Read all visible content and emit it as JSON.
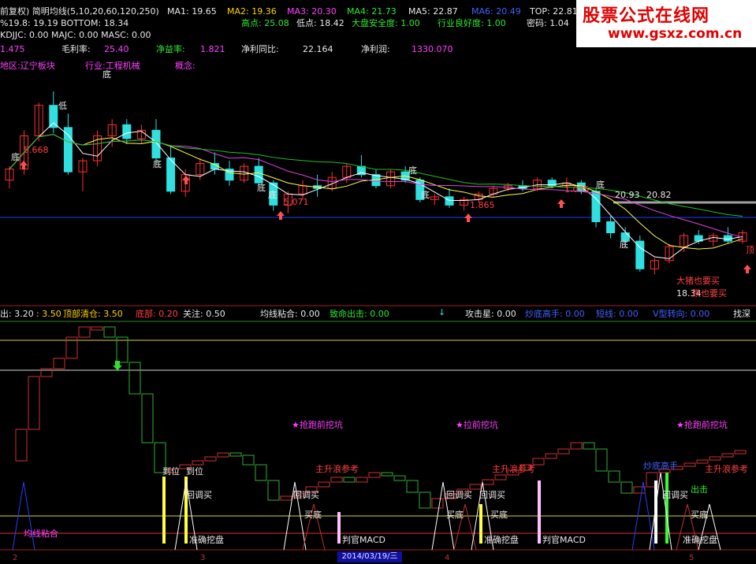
{
  "header": {
    "row1": [
      "前复权) 简明均线(5,10,20,60,120,250)",
      "MA1: 19.65",
      "MA2: 19.36",
      "MA3: 20.30",
      "MA4: 21.73",
      "MA5: 22.87",
      "MA6: 20.49",
      "TOP: 22.81"
    ],
    "row2a": "%19.8: 19.19 BOTTOM: 18.34",
    "row2b": [
      "高点: 25.08",
      "低点: 18.42",
      "大盘安全度: 1.00",
      "行业良好度: 1.00",
      "密码: 1.04"
    ],
    "row3": "KDJJC: 0.00  MAJC: 0.00  MASC: 0.00",
    "row4": [
      "1.475",
      "毛利率:",
      "25.40",
      "净益率:",
      "1.821",
      "净利同比:",
      "22.164",
      "净利润:",
      "1330.070"
    ],
    "row5": [
      "地区:辽宁板块",
      "行业:工程机械",
      "概念:"
    ]
  },
  "main_labels": {
    "low_a": "5.668",
    "low_b": "5.071",
    "low_c": "1.865",
    "low_d": "1.035",
    "flat_1": "20.93",
    "flat_2": "20.82",
    "low_final": "18.34",
    "note_1": "大猪也要买",
    "note_2": "跌也要买",
    "bottom_tag": "底",
    "bottom_tag2": "低",
    "ding_tag": "顶"
  },
  "indicator_row": {
    "items": [
      "出: 3.20",
      ": 3.50",
      "顶部清仓: 3.50",
      "底部: 0.20",
      "关注: 0.50",
      "均线粘合: 0.00",
      "致命出击: 0.00",
      "攻击星: 0.00",
      "炒底高手: 0.00",
      "短线: 0.00",
      "V型转向: 0.00",
      "找深"
    ]
  },
  "lower_labels": {
    "dig_1": "★抢跑前挖坑",
    "dig_2": "★拉前挖坑",
    "dig_3": "★抢跑前挖坑",
    "arrive_1": "到位",
    "arrive_2": "到位",
    "main_up_1": "主升浪参考",
    "main_up_2": "主升浪参考",
    "main_up_3": "主升浪参考",
    "pullback": [
      "回调买",
      "回调买",
      "回调买",
      "回调买",
      "回调买"
    ],
    "buy_bottom": [
      "买底",
      "买底",
      "买底",
      "买底"
    ],
    "ma_stick": "均线粘合",
    "accurate": [
      "准确挖盘",
      "准确挖盘",
      "准确挖盘"
    ],
    "macd": [
      "判官MACD",
      "判官MACD"
    ],
    "deep_buy": "炒底高手",
    "attack": "出击"
  },
  "axis": {
    "marks": [
      "2",
      "3",
      "4",
      "5"
    ],
    "date": "2014/03/19/三"
  },
  "brand": {
    "title": "股票公式在线网",
    "url": "www.gsxz.com.cn"
  },
  "colors": {
    "up": "#ff3030",
    "down": "#30e0e0",
    "ma_white": "#ffffff",
    "ma_yellow": "#ffff40",
    "ma_magenta": "#e040e0",
    "ma_green": "#20c020",
    "ma_blue": "#2040ff"
  },
  "chart_data": {
    "type": "candlestick",
    "candles": [
      [
        21.8,
        22.3,
        21.5,
        22.2
      ],
      [
        22.2,
        23.6,
        22.0,
        23.4
      ],
      [
        23.4,
        24.6,
        23.2,
        24.5
      ],
      [
        24.5,
        25.0,
        23.5,
        23.7
      ],
      [
        23.7,
        24.2,
        22.0,
        22.1
      ],
      [
        22.1,
        22.6,
        21.4,
        22.5
      ],
      [
        22.5,
        23.6,
        22.3,
        23.4
      ],
      [
        23.4,
        24.0,
        23.0,
        23.8
      ],
      [
        23.8,
        24.0,
        23.1,
        23.3
      ],
      [
        23.3,
        23.8,
        23.1,
        23.6
      ],
      [
        23.6,
        24.0,
        22.4,
        22.6
      ],
      [
        22.6,
        23.0,
        21.3,
        21.4
      ],
      [
        21.4,
        22.2,
        21.2,
        22.0
      ],
      [
        22.0,
        22.6,
        21.8,
        22.4
      ],
      [
        22.4,
        22.8,
        22.0,
        22.2
      ],
      [
        22.2,
        22.5,
        21.6,
        21.8
      ],
      [
        21.8,
        22.4,
        21.7,
        22.3
      ],
      [
        22.3,
        22.6,
        21.6,
        21.7
      ],
      [
        21.7,
        21.8,
        20.7,
        20.9
      ],
      [
        20.9,
        21.4,
        20.6,
        21.3
      ],
      [
        21.3,
        21.8,
        21.1,
        21.6
      ],
      [
        21.6,
        22.0,
        21.2,
        21.5
      ],
      [
        21.5,
        22.1,
        21.4,
        21.9
      ],
      [
        21.9,
        22.4,
        21.7,
        22.3
      ],
      [
        22.3,
        22.7,
        21.9,
        22.0
      ],
      [
        22.0,
        22.2,
        21.5,
        21.6
      ],
      [
        21.6,
        22.2,
        21.5,
        22.1
      ],
      [
        22.1,
        22.3,
        21.7,
        21.8
      ],
      [
        21.8,
        21.9,
        21.0,
        21.1
      ],
      [
        21.1,
        21.3,
        20.9,
        21.2
      ],
      [
        21.2,
        21.5,
        20.8,
        20.9
      ],
      [
        20.9,
        21.2,
        20.7,
        21.1
      ],
      [
        21.1,
        21.4,
        21.0,
        21.3
      ],
      [
        21.3,
        21.6,
        21.2,
        21.5
      ],
      [
        21.5,
        21.7,
        21.4,
        21.6
      ],
      [
        21.6,
        21.8,
        21.4,
        21.5
      ],
      [
        21.5,
        21.9,
        21.4,
        21.8
      ],
      [
        21.8,
        21.9,
        21.5,
        21.6
      ],
      [
        21.6,
        21.9,
        21.5,
        21.7
      ],
      [
        21.7,
        21.8,
        21.3,
        21.4
      ],
      [
        21.4,
        21.5,
        20.1,
        20.3
      ],
      [
        20.3,
        20.5,
        19.7,
        19.9
      ],
      [
        19.9,
        20.1,
        19.4,
        19.6
      ],
      [
        19.6,
        19.8,
        18.5,
        18.6
      ],
      [
        18.6,
        19.0,
        18.4,
        18.9
      ],
      [
        18.9,
        19.5,
        18.8,
        19.4
      ],
      [
        19.4,
        19.9,
        19.2,
        19.8
      ],
      [
        19.8,
        20.0,
        19.5,
        19.6
      ],
      [
        19.6,
        19.9,
        19.4,
        19.8
      ],
      [
        19.8,
        20.1,
        19.5,
        19.6
      ],
      [
        19.6,
        20.0,
        19.5,
        19.9
      ]
    ]
  }
}
